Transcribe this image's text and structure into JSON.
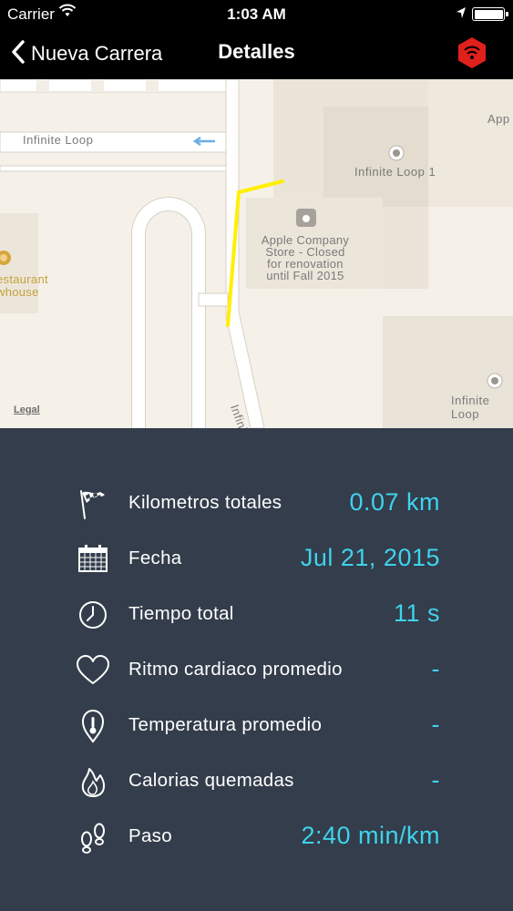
{
  "status_bar": {
    "carrier": "Carrier",
    "time": "1:03 AM",
    "battery_percent": 100
  },
  "nav": {
    "back_label": "Nueva Carrera",
    "title": "Detalles",
    "right_icon": "heart-rate-sensor-icon",
    "right_icon_color": "#e0201b"
  },
  "map": {
    "labels": {
      "street_top": "Infinite Loop",
      "street_side": "Infinite Loop",
      "building_1": "Infinite Loop 1",
      "building_2": "Infinite Loop",
      "app_partial": "App",
      "store": [
        "Apple Company",
        "Store - Closed",
        "for renovation",
        "until Fall 2015"
      ],
      "restaurant": [
        "estaurant",
        "whouse"
      ]
    },
    "legal": "Legal",
    "route_color": "#ffef00"
  },
  "stats": [
    {
      "icon": "checkered-flag-icon",
      "label": "Kilometros totales",
      "value": "0.07 km"
    },
    {
      "icon": "calendar-icon",
      "label": "Fecha",
      "value": "Jul 21, 2015"
    },
    {
      "icon": "clock-icon",
      "label": "Tiempo total",
      "value": "11 s"
    },
    {
      "icon": "heart-icon",
      "label": "Ritmo cardiaco promedio",
      "value": "-"
    },
    {
      "icon": "thermometer-icon",
      "label": "Temperatura promedio",
      "value": "-"
    },
    {
      "icon": "flame-icon",
      "label": "Calorias quemadas",
      "value": "-"
    },
    {
      "icon": "footsteps-icon",
      "label": "Paso",
      "value": "2:40 min/km"
    }
  ],
  "colors": {
    "panel_background": "#333d4b",
    "value_accent": "#3fd3ec"
  }
}
